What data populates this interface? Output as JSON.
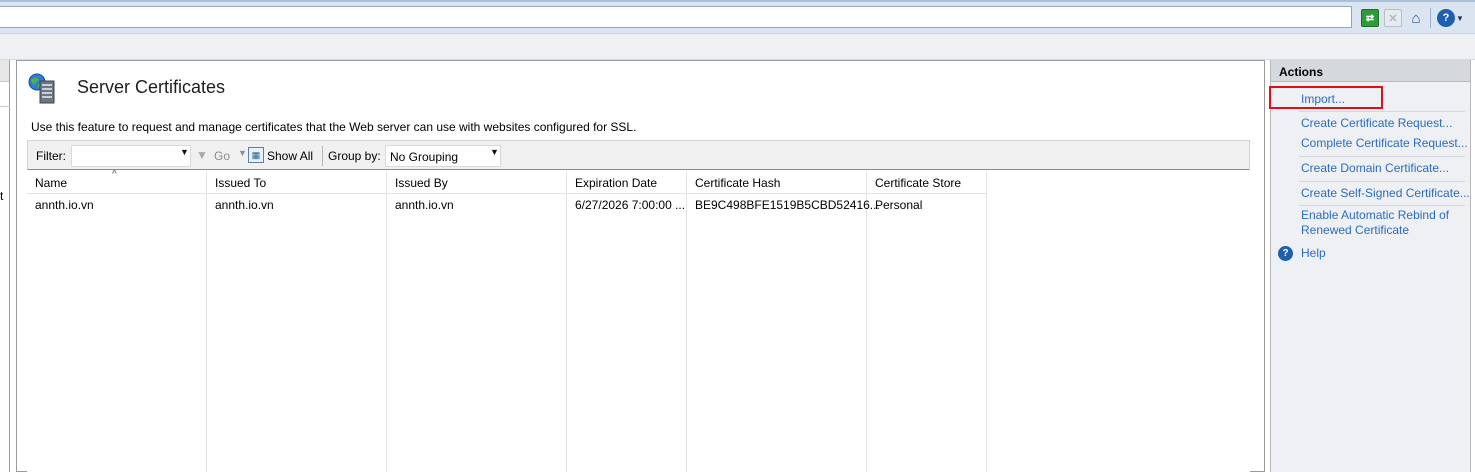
{
  "toolbar": {
    "refresh_icon": "refresh-icon",
    "stop_icon": "stop-icon",
    "home_icon": "home-icon",
    "help_icon": "help-icon"
  },
  "left_pane": {
    "fragment": "t"
  },
  "page": {
    "title": "Server Certificates",
    "description": "Use this feature to request and manage certificates that the Web server can use with websites configured for SSL."
  },
  "filterbar": {
    "filter_label": "Filter:",
    "filter_value": "",
    "go_label": "Go",
    "show_all_label": "Show All",
    "group_by_label": "Group by:",
    "group_by_value": "No Grouping"
  },
  "table": {
    "columns": [
      "Name",
      "Issued To",
      "Issued By",
      "Expiration Date",
      "Certificate Hash",
      "Certificate Store"
    ],
    "rows": [
      [
        "annth.io.vn",
        "annth.io.vn",
        "annth.io.vn",
        "6/27/2026 7:00:00 ...",
        "BE9C498BFE1519B5CBD52416...",
        "Personal"
      ]
    ]
  },
  "actions": {
    "header": "Actions",
    "items": [
      "Import...",
      "Create Certificate Request...",
      "Complete Certificate Request...",
      "Create Domain Certificate...",
      "Create Self-Signed Certificate...",
      "Enable Automatic Rebind of",
      "Renewed Certificate",
      "Help"
    ]
  },
  "colors": {
    "link": "#2b6cc4",
    "highlight": "#e0101a",
    "addressbar": "#dbe5f1"
  }
}
